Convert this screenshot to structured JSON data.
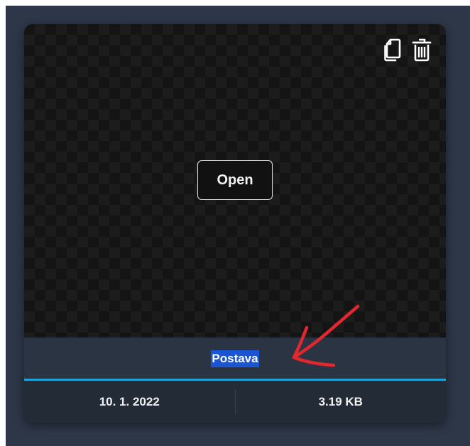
{
  "card": {
    "open_label": "Open",
    "name": "Postava",
    "date": "10. 1. 2022",
    "size": "3.19 KB"
  },
  "icons": {
    "copy": "copy-icon",
    "delete": "trash-icon"
  },
  "colors": {
    "background": "#2d3748",
    "card": "#232b37",
    "selection": "#1a55d6",
    "accent_line": "#1fa1d4",
    "annotation": "#e0282e"
  }
}
